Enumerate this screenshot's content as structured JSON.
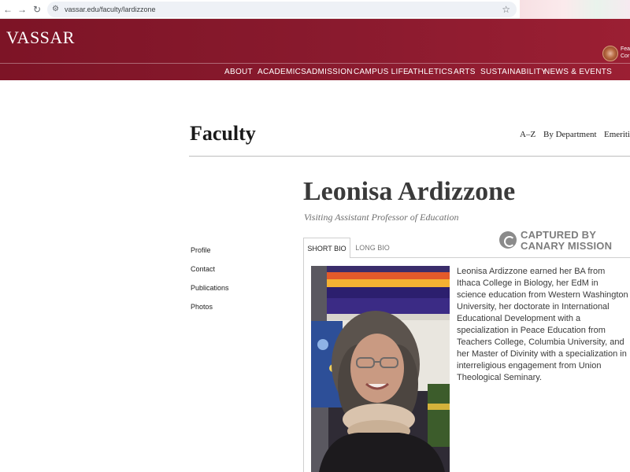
{
  "browser": {
    "back_glyph": "←",
    "forward_glyph": "→",
    "reload_glyph": "↻",
    "site_info_glyph": "⚙",
    "url": "vassar.edu/faculty/lardizzone",
    "star_glyph": "☆"
  },
  "site": {
    "logo": "VASSAR",
    "featured_text_line1": "Fea",
    "featured_text_line2": "Cor",
    "nav": [
      "ABOUT",
      "ACADEMICS",
      "ADMISSION",
      "CAMPUS LIFE",
      "ATHLETICS",
      "ARTS",
      "SUSTAINABILITY",
      "NEWS & EVENTS"
    ],
    "brand_color": "#8a1a2e"
  },
  "faculty": {
    "title": "Faculty",
    "nav": [
      "A–Z",
      "By Department",
      "Emeriti"
    ]
  },
  "person": {
    "name": "Leonisa Ardizzone",
    "title": "Visiting Assistant Professor of Education"
  },
  "side_nav": [
    "Profile",
    "Contact",
    "Publications",
    "Photos"
  ],
  "tabs": {
    "short": "SHORT BIO",
    "long": "LONG BIO",
    "active": "SHORT BIO"
  },
  "watermark": {
    "line1": "CAPTURED BY",
    "line2": "CANARY MISSION"
  },
  "bio": "Leonisa Ardizzone earned her BA from Ithaca College in Biology, her EdM in science education from Western Washington University, her doctorate in International Educational Development with a specialization in Peace Education from Teachers College, Columbia University, and her Master of Divinity with a specialization in interreligious engagement from Union Theological Seminary.",
  "icons": {
    "site_info": "site-info-icon",
    "bookmark": "star-icon",
    "watermark": "canary-mission-logo-icon"
  }
}
